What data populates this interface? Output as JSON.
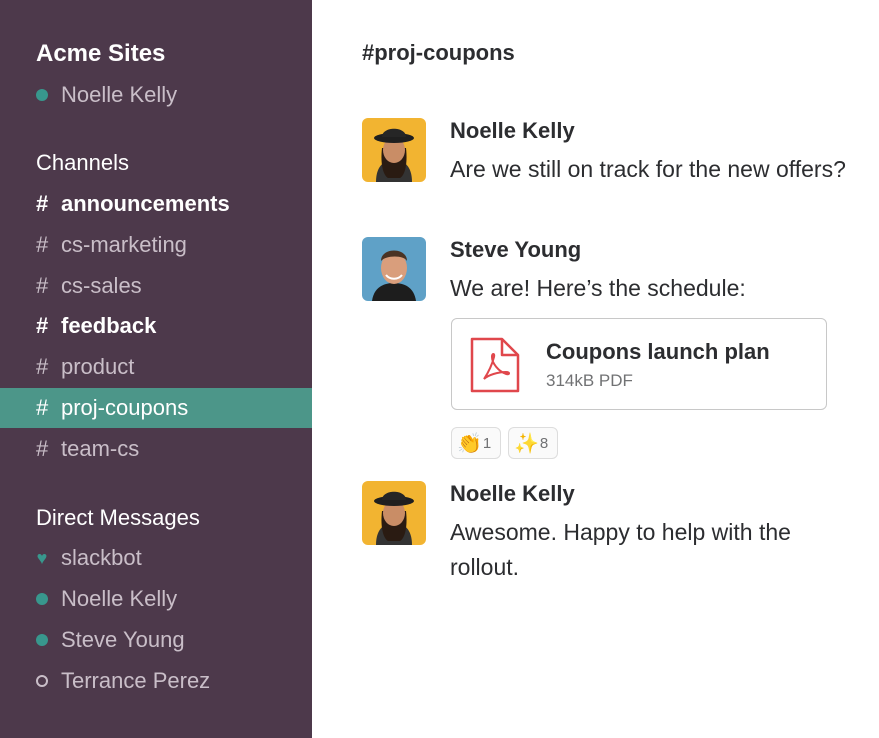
{
  "workspace": {
    "name": "Acme Sites",
    "current_user": "Noelle Kelly"
  },
  "sidebar": {
    "channels_title": "Channels",
    "channels": [
      {
        "hash": "#",
        "name": "announcements",
        "state": "unread"
      },
      {
        "hash": "#",
        "name": "cs-marketing",
        "state": "read"
      },
      {
        "hash": "#",
        "name": "cs-sales",
        "state": "read"
      },
      {
        "hash": "#",
        "name": "feedback",
        "state": "unread"
      },
      {
        "hash": "#",
        "name": "product",
        "state": "read"
      },
      {
        "hash": "#",
        "name": "proj-coupons",
        "state": "active"
      },
      {
        "hash": "#",
        "name": "team-cs",
        "state": "read"
      }
    ],
    "dm_title": "Direct Messages",
    "dms": [
      {
        "name": "slackbot",
        "status": "heart"
      },
      {
        "name": "Noelle Kelly",
        "status": "online"
      },
      {
        "name": "Steve Young",
        "status": "online"
      },
      {
        "name": "Terrance Perez",
        "status": "away"
      }
    ]
  },
  "channel": {
    "title": "#proj-coupons"
  },
  "messages": [
    {
      "author": "Noelle Kelly",
      "text": "Are we still on track for the new offers?"
    },
    {
      "author": "Steve Young",
      "text": "We are! Here’s the schedule:"
    },
    {
      "author": "Noelle Kelly",
      "text": "Awesome. Happy to help with the rollout."
    }
  ],
  "attachment": {
    "name": "Coupons launch plan",
    "meta": "314kB PDF",
    "icon": "pdf-icon"
  },
  "reactions": [
    {
      "emoji": "👏",
      "count": "1",
      "icon": "clap-icon"
    },
    {
      "emoji": "✨",
      "count": "8",
      "icon": "sparkles-icon"
    }
  ],
  "colors": {
    "sidebar": "#4d394b",
    "active": "#4c9689",
    "online": "#38978d",
    "pdf": "#e0474c"
  }
}
